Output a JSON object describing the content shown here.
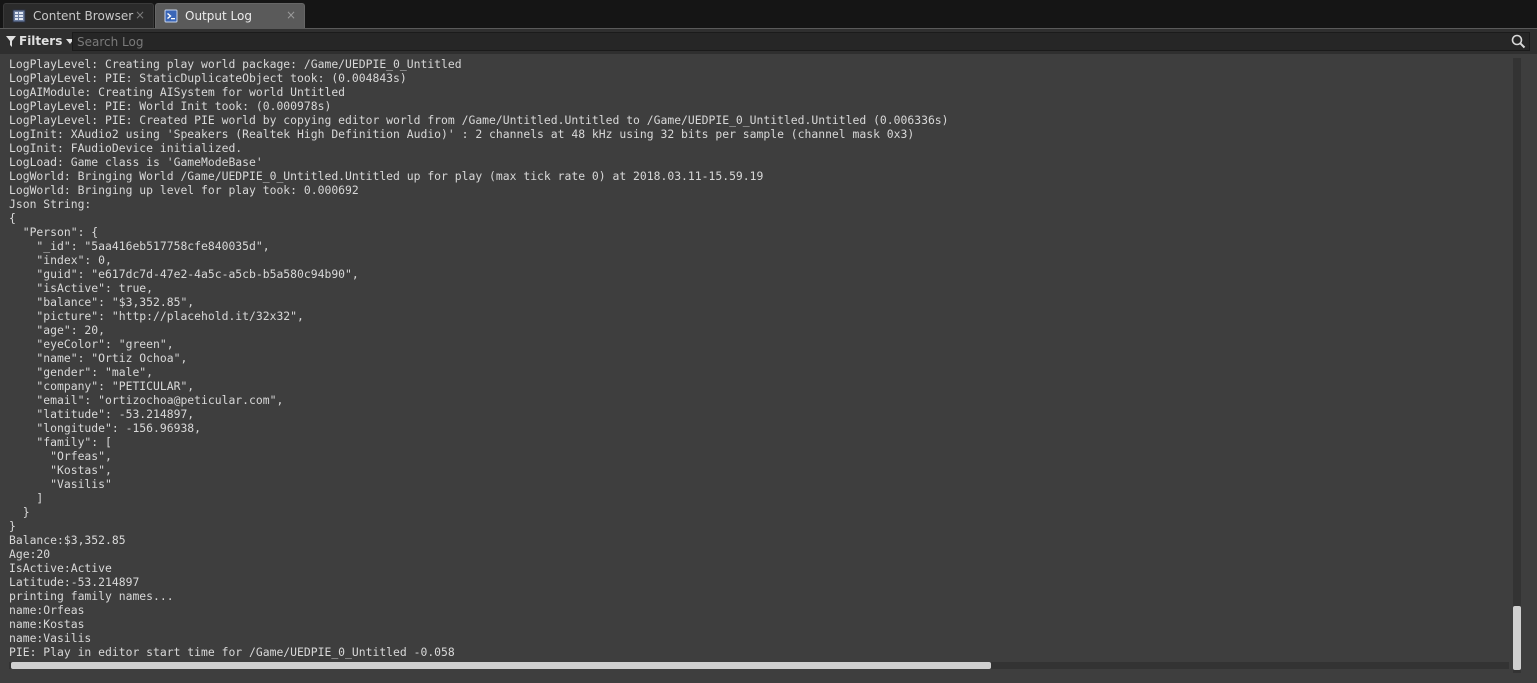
{
  "tabs": [
    {
      "label": "Content Browser",
      "icon": "content-browser-icon",
      "close": "×"
    },
    {
      "label": "Output Log",
      "icon": "output-log-icon",
      "close": "×"
    }
  ],
  "toolbar": {
    "filters_label": "Filters",
    "search_placeholder": "Search Log",
    "search_value": ""
  },
  "log": {
    "lines": [
      "LogPlayLevel: Creating play world package: /Game/UEDPIE_0_Untitled",
      "LogPlayLevel: PIE: StaticDuplicateObject took: (0.004843s)",
      "LogAIModule: Creating AISystem for world Untitled",
      "LogPlayLevel: PIE: World Init took: (0.000978s)",
      "LogPlayLevel: PIE: Created PIE world by copying editor world from /Game/Untitled.Untitled to /Game/UEDPIE_0_Untitled.Untitled (0.006336s)",
      "LogInit: XAudio2 using 'Speakers (Realtek High Definition Audio)' : 2 channels at 48 kHz using 32 bits per sample (channel mask 0x3)",
      "LogInit: FAudioDevice initialized.",
      "LogLoad: Game class is 'GameModeBase'",
      "LogWorld: Bringing World /Game/UEDPIE_0_Untitled.Untitled up for play (max tick rate 0) at 2018.03.11-15.59.19",
      "LogWorld: Bringing up level for play took: 0.000692",
      "Json String:",
      "{",
      "  \"Person\": {",
      "    \"_id\": \"5aa416eb517758cfe840035d\",",
      "    \"index\": 0,",
      "    \"guid\": \"e617dc7d-47e2-4a5c-a5cb-b5a580c94b90\",",
      "    \"isActive\": true,",
      "    \"balance\": \"$3,352.85\",",
      "    \"picture\": \"http://placehold.it/32x32\",",
      "    \"age\": 20,",
      "    \"eyeColor\": \"green\",",
      "    \"name\": \"Ortiz Ochoa\",",
      "    \"gender\": \"male\",",
      "    \"company\": \"PETICULAR\",",
      "    \"email\": \"ortizochoa@peticular.com\",",
      "    \"latitude\": -53.214897,",
      "    \"longitude\": -156.96938,",
      "    \"family\": [",
      "      \"Orfeas\",",
      "      \"Kostas\",",
      "      \"Vasilis\"",
      "    ]",
      "  }",
      "}",
      "Balance:$3,352.85",
      "Age:20",
      "IsActive:Active",
      "Latitude:-53.214897",
      "printing family names...",
      "name:Orfeas",
      "name:Kostas",
      "name:Vasilis",
      "PIE: Play in editor start time for /Game/UEDPIE_0_Untitled -0.058"
    ]
  },
  "colors": {
    "background": "#3e3e3e",
    "text": "#d8d8d8",
    "active_tab": "#5a5a5a",
    "scroll_thumb": "#d0d0d0"
  }
}
